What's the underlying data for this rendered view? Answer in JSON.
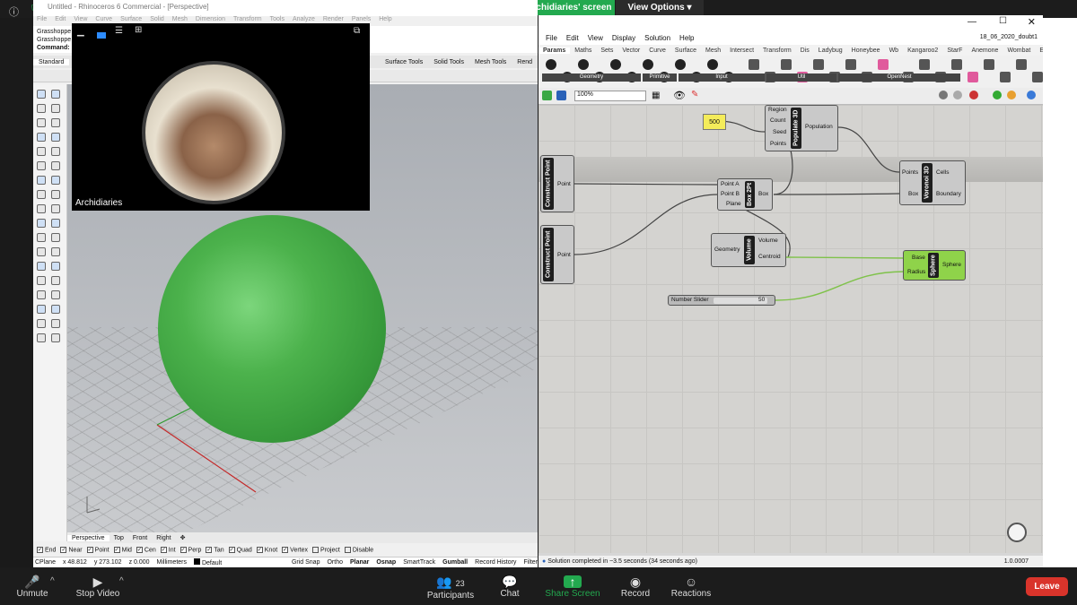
{
  "zoom": {
    "banner": "You are viewing Archidiaries' screen",
    "view_options": "View Options",
    "bottom": {
      "unmute": "Unmute",
      "stop_video": "Stop Video",
      "participants": "Participants",
      "participant_count": "23",
      "chat": "Chat",
      "share_screen": "Share Screen",
      "record": "Record",
      "reactions": "Reactions",
      "leave": "Leave"
    }
  },
  "camera": {
    "name": "Archidiaries"
  },
  "rhino": {
    "title": "Untitled - Rhinoceros 6 Commercial - [Perspective]",
    "menu": [
      "File",
      "Edit",
      "View",
      "Curve",
      "Surface",
      "Solid",
      "Mesh",
      "Dimension",
      "Transform",
      "Tools",
      "Analyze",
      "Render",
      "Panels",
      "Help"
    ],
    "cmd_lines": [
      "Grasshoppe",
      "Grasshoppe",
      "Command:"
    ],
    "tabs": [
      "Standard",
      "Surface Tools",
      "Solid Tools",
      "Mesh Tools",
      "Rend"
    ],
    "view_tabs": [
      "Perspective",
      "Top",
      "Front",
      "Right"
    ],
    "osnaps": [
      "End",
      "Near",
      "Point",
      "Mid",
      "Cen",
      "Int",
      "Perp",
      "Tan",
      "Quad",
      "Knot",
      "Vertex",
      "Project",
      "Disable"
    ],
    "status": {
      "cplane": "CPlane",
      "x": "x 48.812",
      "y": "y 273.102",
      "z": "z 0.000",
      "units": "Millimeters",
      "layer": "Default",
      "grid_snap": "Grid Snap",
      "ortho": "Ortho",
      "planar": "Planar",
      "osnap": "Osnap",
      "smarttrack": "SmartTrack",
      "gumball": "Gumball",
      "record_history": "Record History",
      "filter": "Filter"
    }
  },
  "gh": {
    "file": "18_06_2020_doubt1",
    "menu": [
      "File",
      "Edit",
      "View",
      "Display",
      "Solution",
      "Help"
    ],
    "tabs": [
      "Params",
      "Maths",
      "Sets",
      "Vector",
      "Curve",
      "Surface",
      "Mesh",
      "Intersect",
      "Transform",
      "Dis",
      "Ladybug",
      "Honeybee",
      "Wb",
      "Kangaroo2",
      "StarF",
      "Anemone",
      "Wombat",
      "Extra"
    ],
    "categories": [
      "Geometry",
      "Primitive",
      "Input",
      "Util",
      "OpenNest"
    ],
    "zoom": "100%",
    "status": "Solution completed in ~3.5 seconds (34 seconds ago)",
    "version": "1.0.0007",
    "nodes": {
      "panel_value": "500",
      "populate": {
        "title": "Populate 3D",
        "inputs": [
          "Region",
          "Count",
          "Seed",
          "Points"
        ],
        "output": "Population"
      },
      "cp1": {
        "title": "Construct Point",
        "output": "Point"
      },
      "cp2": {
        "title": "Construct Point",
        "output": "Point"
      },
      "box": {
        "title": "Box 2Pt",
        "inputs": [
          "Point A",
          "Point B",
          "Plane"
        ],
        "output": "Box"
      },
      "voronoi": {
        "title": "Voronoi 3D",
        "inputs": [
          "Points",
          "Box"
        ],
        "outputs": [
          "Cells",
          "Boundary"
        ]
      },
      "volume": {
        "title": "Volume",
        "input": "Geometry",
        "outputs": [
          "Volume",
          "Centroid"
        ]
      },
      "sphere": {
        "title": "Sphere",
        "inputs": [
          "Base",
          "Radius"
        ],
        "output": "Sphere"
      },
      "slider": {
        "label": "Number Slider",
        "value": "50"
      }
    }
  },
  "colors": {
    "accent": "#23a94f",
    "sphere": "#4cb24c",
    "leave": "#d9342b",
    "gh_green": "#8fd34a"
  }
}
